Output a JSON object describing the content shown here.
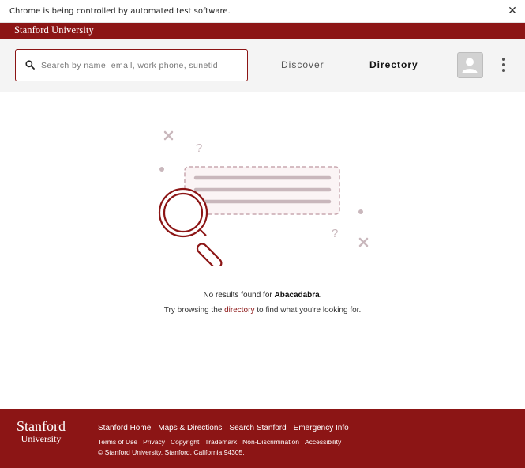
{
  "infobar": {
    "message": "Chrome is being controlled by automated test software.",
    "close_symbol": "✕"
  },
  "brand": {
    "name": "Stanford University"
  },
  "search": {
    "placeholder": "Search by name, email, work phone, sunetid",
    "value": ""
  },
  "nav": {
    "discover": "Discover",
    "directory": "Directory"
  },
  "colors": {
    "cardinal": "#8c1515",
    "header_bg": "#f4f4f4",
    "illustration": "#8c1515"
  },
  "empty_state": {
    "no_results_prefix": "No results found for ",
    "query": "Abacadabra",
    "no_results_suffix": ".",
    "browse_prefix": "Try browsing the ",
    "browse_link": "directory",
    "browse_suffix": " to find what you're looking for."
  },
  "footer": {
    "logo_line1": "Stanford",
    "logo_line2": "University",
    "primary_links": [
      "Stanford Home",
      "Maps & Directions",
      "Search Stanford",
      "Emergency Info"
    ],
    "secondary_links": [
      "Terms of Use",
      "Privacy",
      "Copyright",
      "Trademark",
      "Non-Discrimination",
      "Accessibility"
    ],
    "copyright": "© Stanford University. Stanford, California 94305."
  }
}
